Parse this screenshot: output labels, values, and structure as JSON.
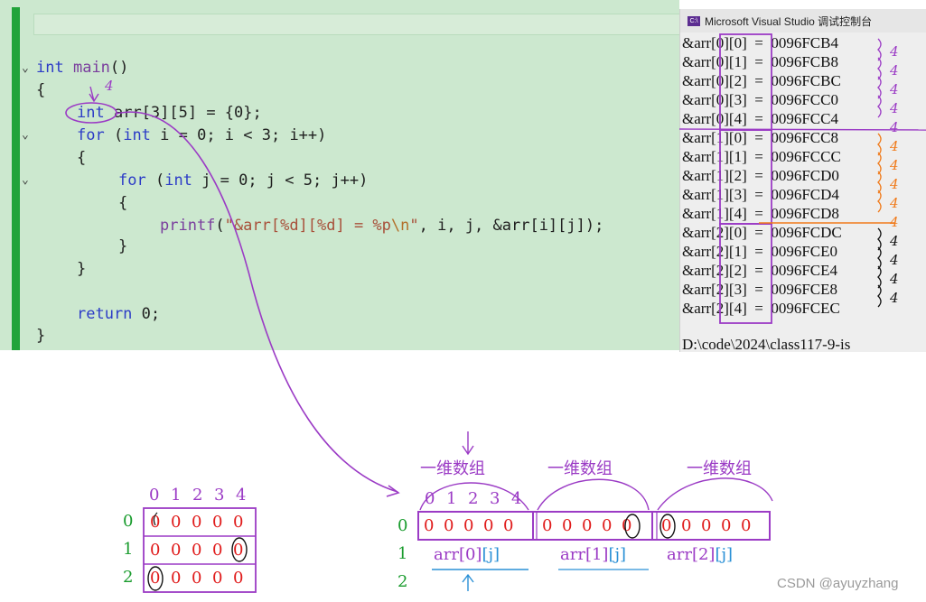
{
  "editor": {
    "lines": [
      {
        "text": "int main()"
      },
      {
        "text": "{"
      },
      {
        "text": "int arr[3][5] = {0};"
      },
      {
        "text": "for (int i = 0; i < 3; i++)"
      },
      {
        "text": "{"
      },
      {
        "text": "for (int j = 0; j < 5; j++)"
      },
      {
        "text": "{"
      },
      {
        "text": "printf(\"&arr[%d][%d] = %p\\n\", i, j, &arr[i][j]);"
      },
      {
        "text": "}"
      },
      {
        "text": "}"
      },
      {
        "text": "return 0;"
      },
      {
        "text": "}"
      }
    ],
    "annotation_above_int": "4"
  },
  "console": {
    "title": "Microsoft Visual Studio 调试控制台",
    "icon_label": "C:\\",
    "rows": [
      {
        "expr": "&arr[0][0]",
        "addr": "0096FCB4",
        "note": "4"
      },
      {
        "expr": "&arr[0][1]",
        "addr": "0096FCB8",
        "note": "4"
      },
      {
        "expr": "&arr[0][2]",
        "addr": "0096FCBC",
        "note": "4"
      },
      {
        "expr": "&arr[0][3]",
        "addr": "0096FCC0",
        "note": "4"
      },
      {
        "expr": "&arr[0][4]",
        "addr": "0096FCC4",
        "note": "4"
      },
      {
        "expr": "&arr[1][0]",
        "addr": "0096FCC8",
        "note": "4"
      },
      {
        "expr": "&arr[1][1]",
        "addr": "0096FCCC",
        "note": "4"
      },
      {
        "expr": "&arr[1][2]",
        "addr": "0096FCD0",
        "note": "4"
      },
      {
        "expr": "&arr[1][3]",
        "addr": "0096FCD4",
        "note": "4"
      },
      {
        "expr": "&arr[1][4]",
        "addr": "0096FCD8",
        "note": "4"
      },
      {
        "expr": "&arr[2][0]",
        "addr": "0096FCDC",
        "note": "4"
      },
      {
        "expr": "&arr[2][1]",
        "addr": "0096FCE0",
        "note": "4"
      },
      {
        "expr": "&arr[2][2]",
        "addr": "0096FCE4",
        "note": "4"
      },
      {
        "expr": "&arr[2][3]",
        "addr": "0096FCE8",
        "note": "4"
      },
      {
        "expr": "&arr[2][4]",
        "addr": "0096FCEC",
        "note": "4"
      }
    ],
    "path_line": "D:\\code\\2024\\class117-9-is"
  },
  "grid2d": {
    "col_headers": [
      "0",
      "1",
      "2",
      "3",
      "4"
    ],
    "row_labels": [
      "0",
      "1",
      "2"
    ],
    "rows": [
      [
        "0",
        "0",
        "0",
        "0",
        "0"
      ],
      [
        "0",
        "0",
        "0",
        "0",
        "0"
      ],
      [
        "0",
        "0",
        "0",
        "0",
        "0"
      ]
    ]
  },
  "linear": {
    "segment_label": "一维数组",
    "col_headers": [
      "0",
      "1",
      "2",
      "3",
      "4"
    ],
    "row_labels": [
      "0",
      "1",
      "2"
    ],
    "segments": [
      [
        "0",
        "0",
        "0",
        "0",
        "0"
      ],
      [
        "0",
        "0",
        "0",
        "0",
        "0"
      ],
      [
        "0",
        "0",
        "0",
        "0",
        "0"
      ]
    ],
    "row_names": [
      {
        "base": "arr[0]",
        "index": "[j]"
      },
      {
        "base": "arr[1]",
        "index": "[j]"
      },
      {
        "base": "arr[2]",
        "index": "[j]"
      }
    ]
  },
  "watermark": "CSDN @ayuyzhang",
  "colors": {
    "editor_bg": "#cce8cf",
    "gutter": "#21a33a",
    "keyword": "#2c3cc7",
    "purple_ink": "#9b3bc5",
    "red_ink": "#e01b1b",
    "orange_ink": "#f07a1a",
    "green_ink": "#1a9c2e",
    "blue_ink": "#2a90d6"
  }
}
